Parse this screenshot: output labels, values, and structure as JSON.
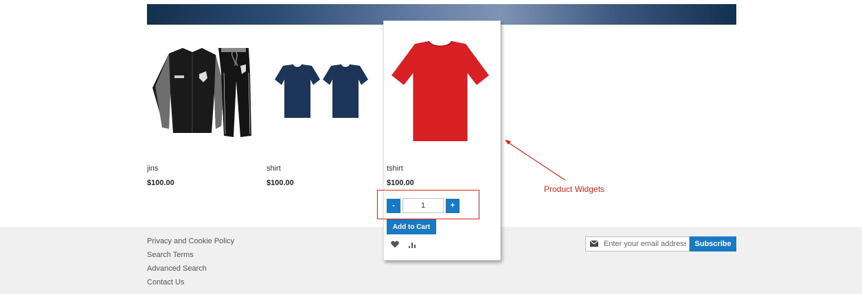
{
  "products": [
    {
      "name": "jins",
      "price": "$100.00",
      "icon": "tracksuit"
    },
    {
      "name": "shirt",
      "price": "$100.00",
      "icon": "navy-tshirts"
    },
    {
      "name": "tshirt",
      "price": "$100.00",
      "icon": "red-tshirt"
    }
  ],
  "hover_card": {
    "qty_minus": "-",
    "qty_value": "1",
    "qty_plus": "+",
    "add_to_cart": "Add to Cart",
    "wishlist_icon": "heart-icon",
    "compare_icon": "bar-chart-icon"
  },
  "annotation": {
    "label": "Product Widgets",
    "color": "#e2231a"
  },
  "footer": {
    "links": [
      "Privacy and Cookie Policy",
      "Search Terms",
      "Advanced Search",
      "Contact Us"
    ],
    "newsletter_placeholder": "Enter your email address",
    "subscribe_label": "Subscribe"
  },
  "colors": {
    "accent": "#1979c3",
    "footer_bg": "#f0f0f0",
    "tshirt_red": "#d92125",
    "shirt_navy": "#1d3558"
  }
}
